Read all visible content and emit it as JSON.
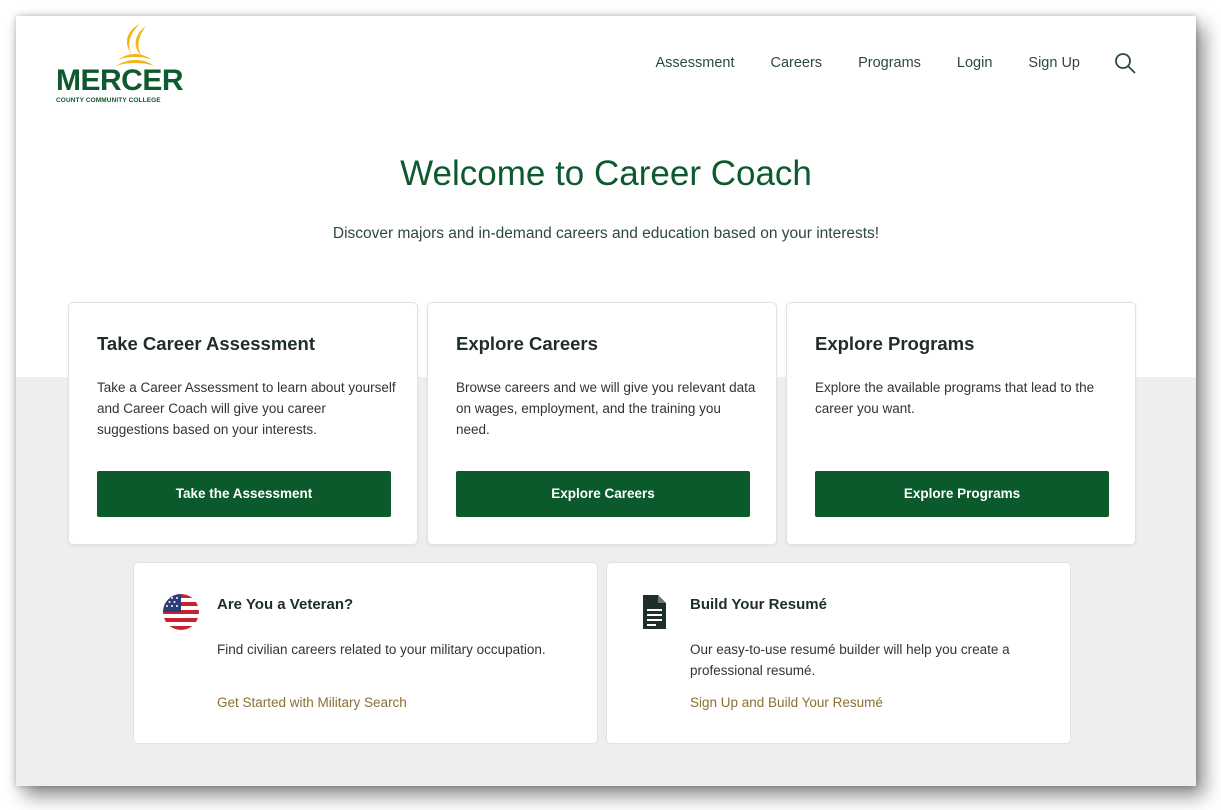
{
  "brand": {
    "name": "MERCER",
    "subtitle": "COUNTY COMMUNITY COLLEGE",
    "color_green": "#0d5a2f",
    "color_gold": "#f2b717"
  },
  "nav": {
    "items": [
      "Assessment",
      "Careers",
      "Programs",
      "Login",
      "Sign Up"
    ],
    "search_icon": "search-icon"
  },
  "hero": {
    "title": "Welcome to Career Coach",
    "subtitle": "Discover majors and in-demand careers and education based on your interests!"
  },
  "cards": [
    {
      "title": "Take Career Assessment",
      "body": "Take a Career Assessment to learn about yourself and Career Coach will give you career suggestions based on your interests.",
      "button": "Take the Assessment"
    },
    {
      "title": "Explore Careers",
      "body": "Browse careers and we will give you relevant data on wages, employment, and the training you need.",
      "button": "Explore Careers"
    },
    {
      "title": "Explore Programs",
      "body": "Explore the available programs that lead to the career you want.",
      "button": "Explore Programs"
    }
  ],
  "veteran": {
    "icon": "us-flag-icon",
    "title": "Are You a Veteran?",
    "body": "Find civilian careers related to your military occupation.",
    "link": "Get Started with Military Search"
  },
  "resume": {
    "icon": "document-icon",
    "title": "Build Your Resumé",
    "body": "Our easy-to-use resumé builder will help you create a professional resumé.",
    "link": "Sign Up and Build Your Resumé"
  }
}
